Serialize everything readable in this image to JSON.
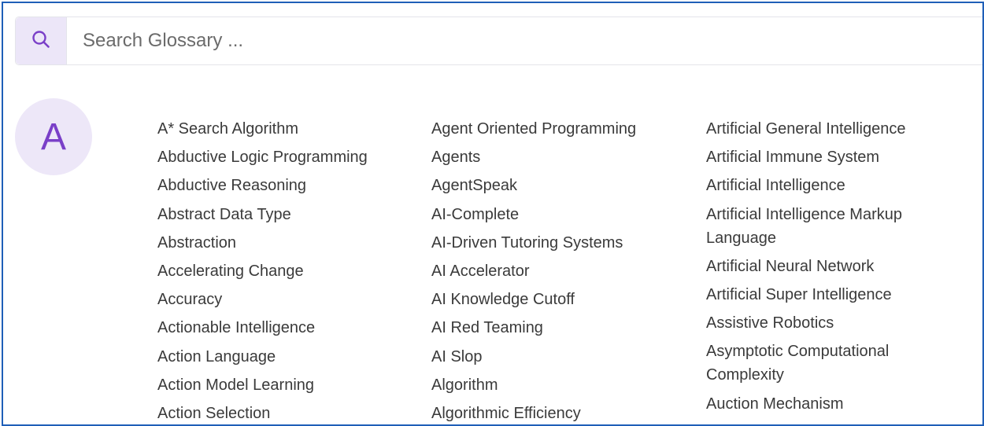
{
  "search": {
    "placeholder": "Search Glossary ..."
  },
  "section": {
    "letter": "A"
  },
  "columns": [
    {
      "terms": [
        "A* Search Algorithm",
        "Abductive Logic Programming",
        "Abductive Reasoning",
        "Abstract Data Type",
        "Abstraction",
        "Accelerating Change",
        "Accuracy",
        "Actionable Intelligence",
        "Action Language",
        "Action Model Learning",
        "Action Selection"
      ]
    },
    {
      "terms": [
        "Agent Oriented Programming",
        "Agents",
        "AgentSpeak",
        "AI-Complete",
        "AI-Driven Tutoring Systems",
        "AI Accelerator",
        "AI Knowledge Cutoff",
        "AI Red Teaming",
        "AI Slop",
        "Algorithm",
        "Algorithmic Efficiency"
      ]
    },
    {
      "terms": [
        "Artificial General Intelligence",
        "Artificial Immune System",
        "Artificial Intelligence",
        "Artificial Intelligence Markup Language",
        "Artificial Neural Network",
        "Artificial Super Intelligence",
        "Assistive Robotics",
        "Asymptotic Computational Complexity",
        "Auction Mechanism"
      ]
    }
  ],
  "colors": {
    "accent": "#7a3fc8",
    "accent_bg": "#ede7f8",
    "frame_border": "#1f5fb8"
  },
  "icons": {
    "search": "search-icon"
  }
}
